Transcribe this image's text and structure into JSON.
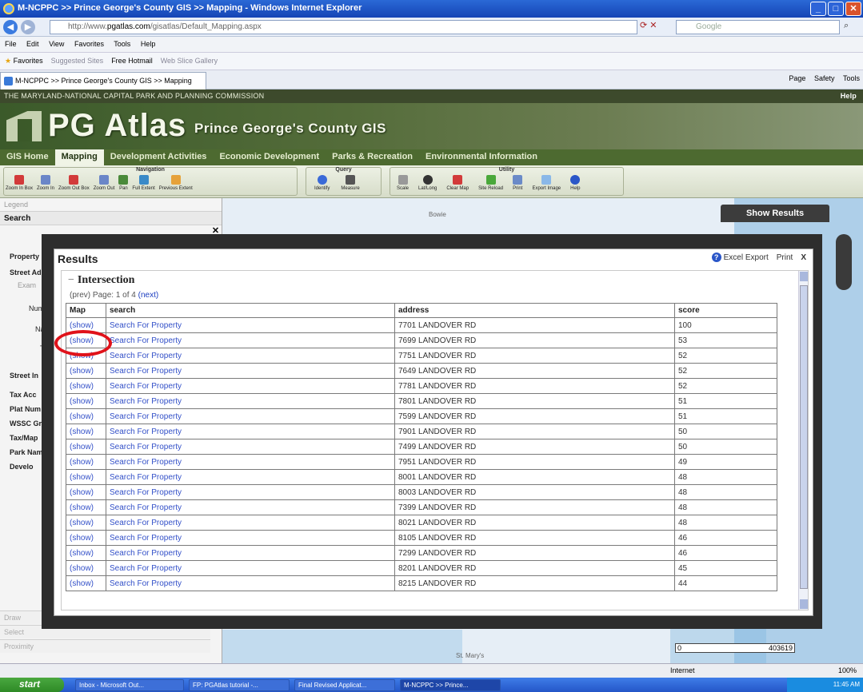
{
  "window": {
    "title": "M-NCPPC >> Prince George's County GIS >> Mapping - Windows Internet Explorer"
  },
  "addressbar": {
    "url_prefix": "http://www.",
    "url_domain": "pgatlas.com",
    "url_suffix": "/gisatlas/Default_Mapping.aspx",
    "search_placeholder": "Google"
  },
  "menubar": [
    "File",
    "Edit",
    "View",
    "Favorites",
    "Tools",
    "Help"
  ],
  "favorites": {
    "label": "Favorites",
    "suggested": "Suggested Sites",
    "hotmail": "Free Hotmail",
    "gallery": "Web Slice Gallery"
  },
  "tab": {
    "label": "M-NCPPC >> Prince George's County GIS >> Mapping"
  },
  "commandbar": [
    "Page",
    "Safety",
    "Tools"
  ],
  "site": {
    "commission": "THE MARYLAND-NATIONAL CAPITAL PARK AND PLANNING COMMISSION",
    "help": "Help",
    "brand": "PG Atlas",
    "brand_sub": "Prince George's County GIS",
    "nav": [
      "GIS Home",
      "Mapping",
      "Development Activities",
      "Economic Development",
      "Parks & Recreation",
      "Environmental Information"
    ]
  },
  "toolbar": {
    "navigation_label": "Navigation",
    "navigation_tools": [
      "Zoom In Box",
      "Zoom In",
      "Zoom Out Box",
      "Zoom Out",
      "Pan",
      "Full Extent",
      "Previous Extent"
    ],
    "query_label": "Query",
    "query_tools": [
      "Identify",
      "Measure"
    ],
    "utility_label": "Utility",
    "utility_tools": [
      "Scale",
      "Lat/Long",
      "Clear Map",
      "Site Reload",
      "Print",
      "Export Image",
      "Help"
    ]
  },
  "sidebar": {
    "legend": "Legend",
    "search": "Search",
    "items": [
      "Property",
      "Street Ad",
      "Exam",
      "Numb",
      "Na",
      "T",
      "Street In",
      "Tax Acc",
      "Plat Num",
      "WSSC Gr",
      "Tax/Map",
      "Park Nam",
      "Develo"
    ],
    "bottom": [
      "Draw",
      "Select",
      "Proximity"
    ]
  },
  "map": {
    "show_results": "Show Results",
    "labels": [
      "Bowie",
      "St. Mary's"
    ],
    "scale_start": "0",
    "scale_end": "403619"
  },
  "results": {
    "title": "Results",
    "excel": "Excel Export",
    "print": "Print",
    "close": "X",
    "section": "Intersection",
    "paging_prev": "(prev)",
    "paging_text": "Page: 1 of 4",
    "paging_next": "(next)",
    "columns": [
      "Map",
      "search",
      "address",
      "score"
    ],
    "rows": [
      {
        "map": "(show)",
        "search": "Search For Property",
        "address": "7701 LANDOVER RD",
        "score": "100"
      },
      {
        "map": "(show)",
        "search": "Search For Property",
        "address": "7699 LANDOVER RD",
        "score": "53"
      },
      {
        "map": "(show)",
        "search": "Search For Property",
        "address": "7751 LANDOVER RD",
        "score": "52"
      },
      {
        "map": "(show)",
        "search": "Search For Property",
        "address": "7649 LANDOVER RD",
        "score": "52"
      },
      {
        "map": "(show)",
        "search": "Search For Property",
        "address": "7781 LANDOVER RD",
        "score": "52"
      },
      {
        "map": "(show)",
        "search": "Search For Property",
        "address": "7801 LANDOVER RD",
        "score": "51"
      },
      {
        "map": "(show)",
        "search": "Search For Property",
        "address": "7599 LANDOVER RD",
        "score": "51"
      },
      {
        "map": "(show)",
        "search": "Search For Property",
        "address": "7901 LANDOVER RD",
        "score": "50"
      },
      {
        "map": "(show)",
        "search": "Search For Property",
        "address": "7499 LANDOVER RD",
        "score": "50"
      },
      {
        "map": "(show)",
        "search": "Search For Property",
        "address": "7951 LANDOVER RD",
        "score": "49"
      },
      {
        "map": "(show)",
        "search": "Search For Property",
        "address": "8001 LANDOVER RD",
        "score": "48"
      },
      {
        "map": "(show)",
        "search": "Search For Property",
        "address": "8003 LANDOVER RD",
        "score": "48"
      },
      {
        "map": "(show)",
        "search": "Search For Property",
        "address": "7399 LANDOVER RD",
        "score": "48"
      },
      {
        "map": "(show)",
        "search": "Search For Property",
        "address": "8021 LANDOVER RD",
        "score": "48"
      },
      {
        "map": "(show)",
        "search": "Search For Property",
        "address": "8105 LANDOVER RD",
        "score": "46"
      },
      {
        "map": "(show)",
        "search": "Search For Property",
        "address": "7299 LANDOVER RD",
        "score": "46"
      },
      {
        "map": "(show)",
        "search": "Search For Property",
        "address": "8201 LANDOVER RD",
        "score": "45"
      },
      {
        "map": "(show)",
        "search": "Search For Property",
        "address": "8215 LANDOVER RD",
        "score": "44"
      }
    ]
  },
  "status": {
    "zone": "Internet",
    "zoom": "100%"
  },
  "taskbar": {
    "start": "start",
    "items": [
      "Inbox - Microsoft Out...",
      "FP: PGAtlas tutorial -...",
      "Final Revised Applicat...",
      "M-NCPPC >> Prince..."
    ],
    "clock": "11:45 AM"
  },
  "colors": {
    "accent_red": "#e0121a",
    "site_green": "#4d6a30",
    "link_blue": "#3350c8"
  }
}
